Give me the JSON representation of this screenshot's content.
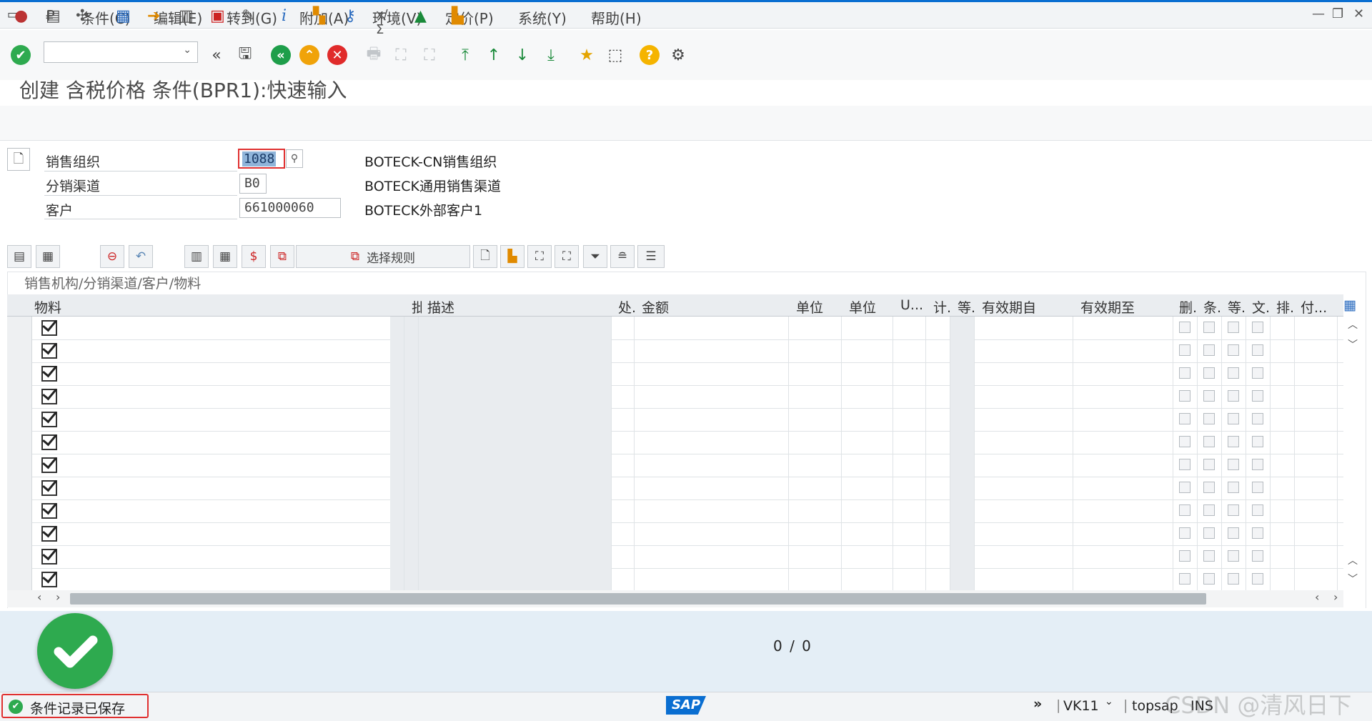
{
  "menu": {
    "items": [
      "条件(C)",
      "编辑(E)",
      "转到(G)",
      "附加(A)",
      "环境(V)",
      "定价(P)",
      "系统(Y)",
      "帮助(H)"
    ]
  },
  "toolbar": {
    "command_field_value": ""
  },
  "title": "创建 含税价格 条件(BPR1):快速输入",
  "header": {
    "sales_org_label": "销售组织",
    "sales_org_value": "1088",
    "sales_org_desc": "BOTECK-CN销售组织",
    "dist_channel_label": "分销渠道",
    "dist_channel_value": "B0",
    "dist_channel_desc": "BOTECK通用销售渠道",
    "customer_label": "客户",
    "customer_value": "661000060",
    "customer_desc": "BOTECK外部客户1"
  },
  "table_toolbar": {
    "select_rule_label": "选择规则"
  },
  "table": {
    "caption": "销售机构/分销渠道/客户/物料",
    "columns": [
      "物料",
      "批",
      "描述",
      "处.",
      "金额",
      "单位",
      "单位",
      "U...",
      "计.",
      "等.",
      "有效期自",
      "有效期至",
      "删.",
      "条.",
      "等.",
      "文.",
      "排.",
      "付..."
    ],
    "row_count": 12
  },
  "footer": {
    "counter": "0 / 0"
  },
  "status": {
    "message": "条件记录已保存",
    "transaction": "VK11",
    "server": "topsap",
    "mode": "INS",
    "logo": "SAP",
    "watermark": "CSDN @清风日下"
  },
  "colors": {
    "success_green": "#2eaa4f",
    "cancel_red": "#e02b2b",
    "exit_orange": "#f0a30a",
    "back_green": "#1e9e4a",
    "help_yellow": "#f5b400",
    "status_highlight": "#e03030"
  }
}
